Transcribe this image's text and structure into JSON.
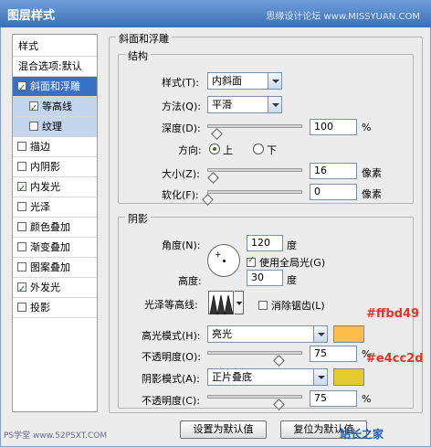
{
  "window": {
    "title": "图层样式",
    "watermark": "思缘设计论坛 www.MISSYUAN.COM"
  },
  "style_list": {
    "items": [
      {
        "label": "样式",
        "checkbox": false,
        "checked": false,
        "state": "header"
      },
      {
        "label": "混合选项:默认",
        "checkbox": false,
        "checked": false,
        "state": "header"
      },
      {
        "label": "斜面和浮雕",
        "checkbox": true,
        "checked": true,
        "state": "selected"
      },
      {
        "label": "等高线",
        "checkbox": true,
        "checked": true,
        "state": "sub"
      },
      {
        "label": "纹理",
        "checkbox": true,
        "checked": false,
        "state": "sub"
      },
      {
        "label": "描边",
        "checkbox": true,
        "checked": false,
        "state": "normal"
      },
      {
        "label": "内阴影",
        "checkbox": true,
        "checked": false,
        "state": "normal"
      },
      {
        "label": "内发光",
        "checkbox": true,
        "checked": true,
        "state": "normal"
      },
      {
        "label": "光泽",
        "checkbox": true,
        "checked": false,
        "state": "normal"
      },
      {
        "label": "颜色叠加",
        "checkbox": true,
        "checked": false,
        "state": "normal"
      },
      {
        "label": "渐变叠加",
        "checkbox": true,
        "checked": false,
        "state": "normal"
      },
      {
        "label": "图案叠加",
        "checkbox": true,
        "checked": false,
        "state": "normal"
      },
      {
        "label": "外发光",
        "checkbox": true,
        "checked": true,
        "state": "normal"
      },
      {
        "label": "投影",
        "checkbox": true,
        "checked": false,
        "state": "normal"
      }
    ]
  },
  "bevel": {
    "group_title": "斜面和浮雕",
    "structure": {
      "title": "结构",
      "style_label": "样式(T):",
      "style_value": "内斜面",
      "technique_label": "方法(Q):",
      "technique_value": "平滑",
      "depth_label": "深度(D):",
      "depth_value": "100",
      "depth_unit": "%",
      "depth_slider_fraction": 0.1,
      "direction_label": "方向:",
      "direction_up": "上",
      "direction_down": "下",
      "direction_selected": "上",
      "size_label": "大小(Z):",
      "size_value": "16",
      "size_unit": "像素",
      "size_slider_fraction": 0.06,
      "soften_label": "软化(F):",
      "soften_value": "0",
      "soften_unit": "像素",
      "soften_slider_fraction": 0.0
    },
    "shading": {
      "title": "阴影",
      "angle_label": "角度(N):",
      "angle_value": "120",
      "angle_unit": "度",
      "global_light_label": "使用全局光(G)",
      "global_light_checked": true,
      "altitude_label": "高度:",
      "altitude_value": "30",
      "altitude_unit": "度",
      "gloss_contour_label": "光泽等高线:",
      "antialias_label": "消除锯齿(L)",
      "antialias_checked": false,
      "highlight_mode_label": "高光模式(H):",
      "highlight_mode_value": "亮光",
      "highlight_color": "#ffbd49",
      "highlight_opacity_label": "不透明度(O):",
      "highlight_opacity_value": "75",
      "highlight_opacity_unit": "%",
      "highlight_opacity_fraction": 0.75,
      "shadow_mode_label": "阴影模式(A):",
      "shadow_mode_value": "正片叠底",
      "shadow_color": "#e4cc2d",
      "shadow_opacity_label": "不透明度(C):",
      "shadow_opacity_value": "75",
      "shadow_opacity_unit": "%",
      "shadow_opacity_fraction": 0.75
    },
    "annotations": {
      "highlight_hex": "#ffbd49",
      "shadow_hex": "#e4cc2d"
    }
  },
  "buttons": {
    "make_default": "设置为默认值",
    "reset_default": "复位为默认值"
  },
  "footer": {
    "left_watermark": "PS学堂 www.52PSXT.COM",
    "right_logo": "站长之家"
  }
}
